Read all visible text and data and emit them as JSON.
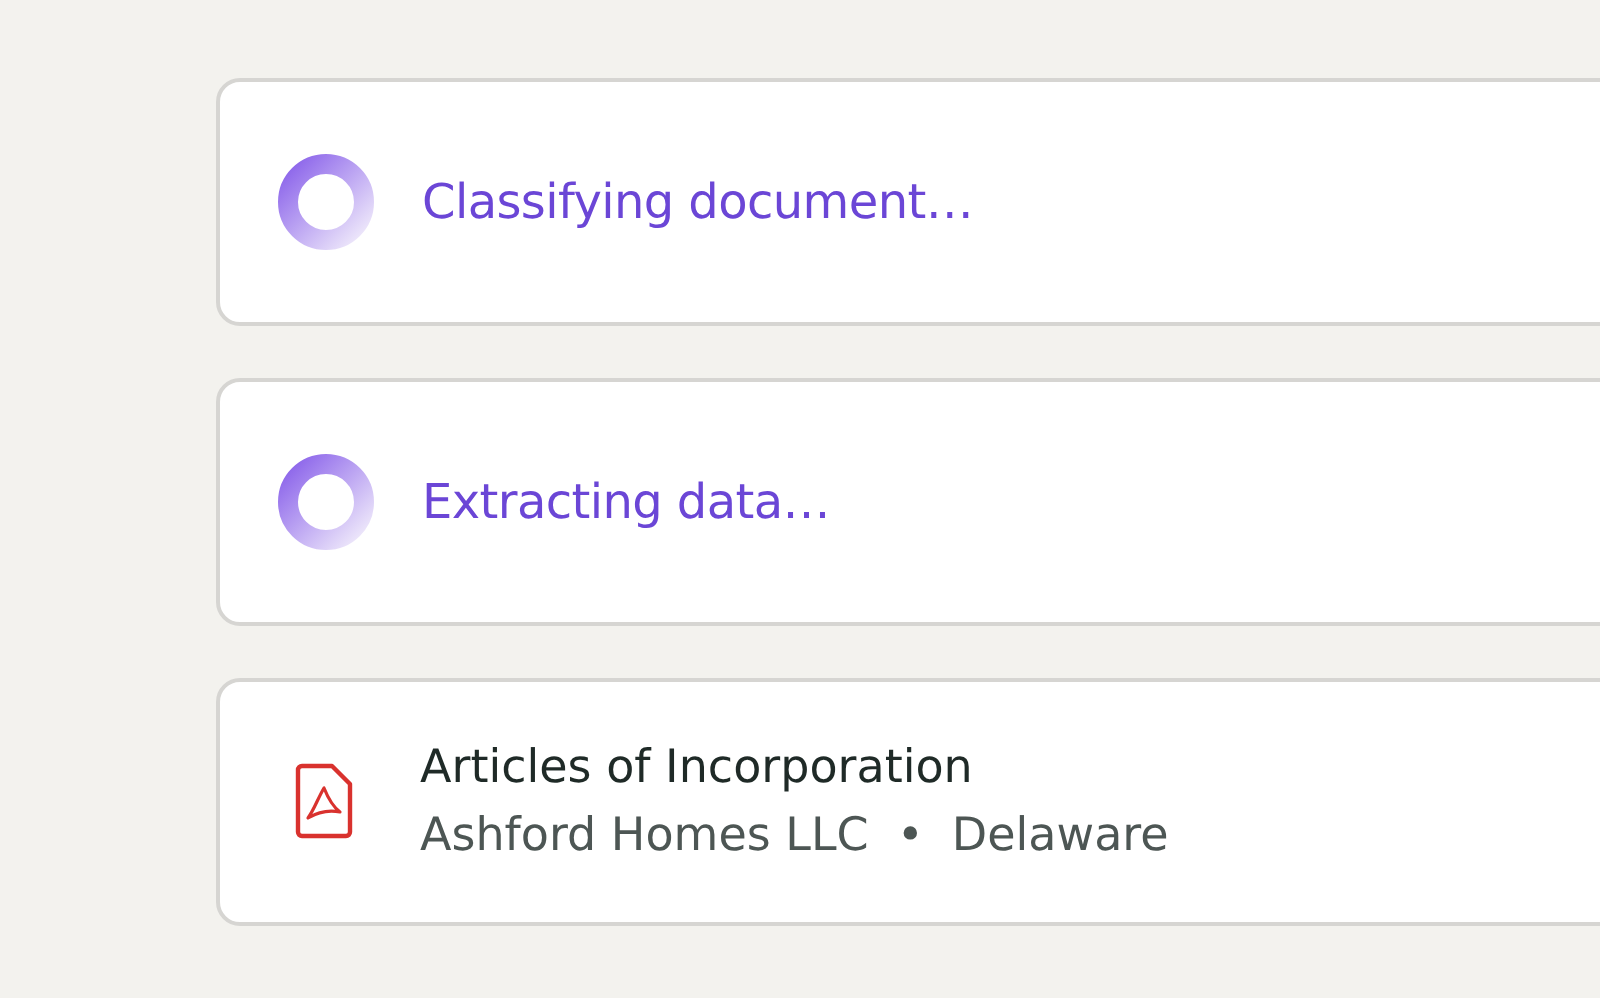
{
  "cards": [
    {
      "kind": "processing",
      "label": "Classifying document…"
    },
    {
      "kind": "processing",
      "label": "Extracting data…"
    },
    {
      "kind": "document",
      "title": "Articles of Incorporation",
      "details": [
        "Ashford Homes LLC",
        "•",
        "Delaware"
      ]
    }
  ]
}
